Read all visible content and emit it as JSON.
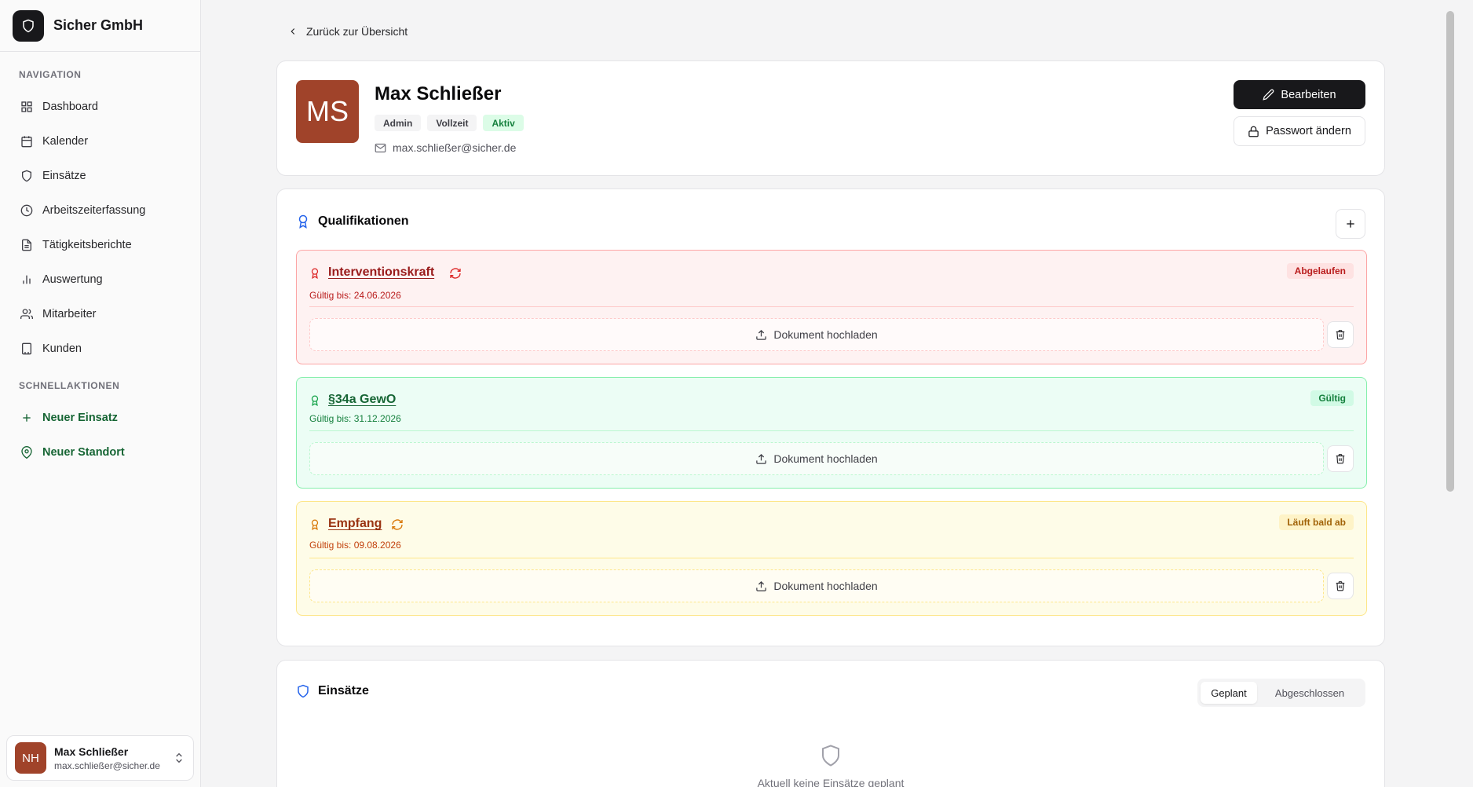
{
  "brand": {
    "name": "Sicher GmbH"
  },
  "sidebar": {
    "nav_label": "NAVIGATION",
    "items": [
      {
        "label": "Dashboard",
        "icon": "dashboard-icon"
      },
      {
        "label": "Kalender",
        "icon": "calendar-icon"
      },
      {
        "label": "Einsätze",
        "icon": "shield-icon"
      },
      {
        "label": "Arbeitszeiterfassung",
        "icon": "clock-icon"
      },
      {
        "label": "Tätigkeitsberichte",
        "icon": "document-icon"
      },
      {
        "label": "Auswertung",
        "icon": "bar-chart-icon"
      },
      {
        "label": "Mitarbeiter",
        "icon": "users-icon"
      },
      {
        "label": "Kunden",
        "icon": "building-icon"
      }
    ],
    "quick_label": "SCHNELLAKTIONEN",
    "quick": [
      {
        "label": "Neuer Einsatz",
        "icon": "plus-icon"
      },
      {
        "label": "Neuer Standort",
        "icon": "map-pin-icon"
      }
    ],
    "user": {
      "initials": "NH",
      "name": "Max Schließer",
      "email": "max.schließer@sicher.de"
    }
  },
  "main": {
    "back_label": "Zurück zur Übersicht",
    "profile": {
      "initials": "MS",
      "name": "Max Schließer",
      "badges": [
        "Admin",
        "Vollzeit",
        "Aktiv"
      ],
      "email": "max.schließer@sicher.de",
      "edit_label": "Bearbeiten",
      "password_label": "Passwort ändern"
    },
    "qualifications": {
      "title": "Qualifikationen",
      "items": [
        {
          "name": "Interventionskraft",
          "valid": "Gültig bis: 24.06.2026",
          "status": "Abgelaufen",
          "upload": "Dokument hochladen",
          "renewable": true,
          "color": "#dc2626"
        },
        {
          "name": "§34a GewO",
          "valid": "Gültig bis: 31.12.2026",
          "status": "Gültig",
          "upload": "Dokument hochladen",
          "renewable": false,
          "color": "#16a34a"
        },
        {
          "name": "Empfang",
          "valid": "Gültig bis: 09.08.2026",
          "status": "Läuft bald ab",
          "upload": "Dokument hochladen",
          "renewable": true,
          "color": "#d97706"
        }
      ]
    },
    "einsaetze": {
      "title": "Einsätze",
      "tabs": [
        "Geplant",
        "Abgeschlossen"
      ],
      "empty_text": "Aktuell keine Einsätze geplant"
    }
  },
  "colors": {
    "accent": "#18181b",
    "avatar": "#a0432a",
    "success": "#15803d",
    "danger": "#b91c1c",
    "warning": "#a16207",
    "brand_blue": "#2563eb"
  }
}
